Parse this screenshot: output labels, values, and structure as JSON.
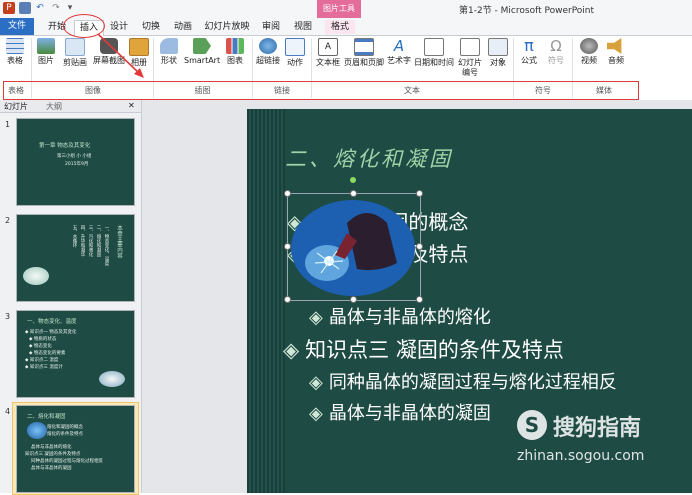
{
  "window": {
    "title": "第1-2节 - Microsoft PowerPoint",
    "picture_tools": "图片工具"
  },
  "tabs": [
    "文件",
    "开始",
    "插入",
    "设计",
    "切换",
    "动画",
    "幻灯片放映",
    "审阅",
    "视图",
    "格式"
  ],
  "ribbon": {
    "buttons": [
      "表格",
      "图片",
      "剪贴画",
      "屏幕截图",
      "相册",
      "形状",
      "SmartArt",
      "图表",
      "超链接",
      "动作",
      "文本框",
      "页眉和页脚",
      "艺术字",
      "日期和时间",
      "幻灯片编号",
      "对象",
      "公式",
      "符号",
      "视频",
      "音频"
    ],
    "groups": [
      "表格",
      "图像",
      "插图",
      "链接",
      "文本",
      "符号",
      "媒体"
    ]
  },
  "pane": {
    "tabs": [
      "幻灯片",
      "大纲"
    ],
    "thumbs": [
      {
        "num": "1",
        "title": "第一章 物态及其变化",
        "lines": [
          "第三小组 小 小组",
          "2015年9月"
        ]
      },
      {
        "num": "2",
        "title": "本章主要内容",
        "lines": [
          "一、物态变化、温度",
          "二、熔化和凝固",
          "三、汽化和液化",
          "四、升华和凝华",
          "五、水循环"
        ]
      },
      {
        "num": "3",
        "title": "一、物态变化、温度",
        "lines": [
          "◆ 知识点一 物态及其变化",
          "◆ 物质的状态",
          "◆ 物态变化",
          "◆ 物态变化的要素",
          "◆ 知识点二 温度",
          "◆ 知识点三 温度计"
        ]
      },
      {
        "num": "4",
        "title": "二、熔化和凝固",
        "lines": [
          "熔化和凝固的概念",
          "熔化的条件及特点",
          "晶体与非晶体的熔化",
          "知识点三 凝固的条件及特点",
          "同种晶体的凝固过程与熔化过程相反",
          "晶体与非晶体的凝固"
        ]
      }
    ]
  },
  "slide": {
    "title": "二、熔化和凝固",
    "bullets": [
      "熔化和凝固的概念",
      "熔化的条件及特点",
      "晶体与非晶体的熔化",
      "知识点三  凝固的条件及特点",
      "同种晶体的凝固过程与熔化过程相反",
      "晶体与非晶体的凝固"
    ]
  },
  "watermark": {
    "text": "搜狗指南",
    "url": "zhinan.sogou.com",
    "logo": "S"
  },
  "colors": {
    "accent": "#2b6fc4",
    "slide_bg": "#1f4b45",
    "title": "#9fd2a6",
    "annotation": "#e03a3a",
    "picture_tools": "#e36c9b"
  }
}
